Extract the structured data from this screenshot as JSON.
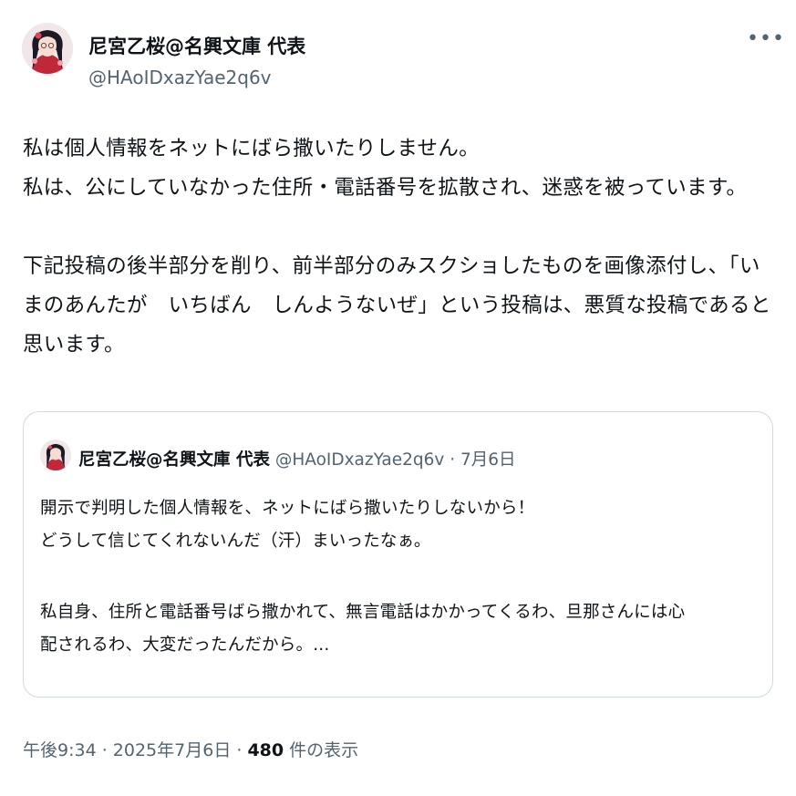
{
  "post": {
    "author_name": "尼宮乙桜@名興文庫 代表",
    "author_handle": "@HAoIDxazYae2q6v",
    "more_icon": "more-horizontal-icon",
    "text_lines": [
      "私は個人情報をネットにばら撒いたりしません。",
      "私は、公にしていなかった住所・電話番号を拡散され、迷惑を被っています。",
      "",
      "下記投稿の後半部分を削り、前半部分のみスクショしたものを画像添付し、「い",
      "まのあんたが　いちばん　しんようないぜ」という投稿は、悪質な投稿であると",
      "思います。"
    ]
  },
  "quoted": {
    "author_name": "尼宮乙桜@名興文庫 代表",
    "author_handle": "@HAoIDxazYae2q6v",
    "separator": " · ",
    "date": "7月6日",
    "text_lines": [
      "開示で判明した個人情報を、ネットにばら撒いたりしないから！",
      "どうして信じてくれないんだ（汗）まいったなぁ。",
      "",
      "私自身、住所と電話番号ばら撒かれて、無言電話はかかってくるわ、旦那さんには心",
      "配されるわ、大変だったんだから。..."
    ]
  },
  "footer": {
    "time": "午後9:34",
    "sep1": " · ",
    "date": "2025年7月6日",
    "sep2": " · ",
    "views_count": "480",
    "views_label": " 件の表示"
  }
}
